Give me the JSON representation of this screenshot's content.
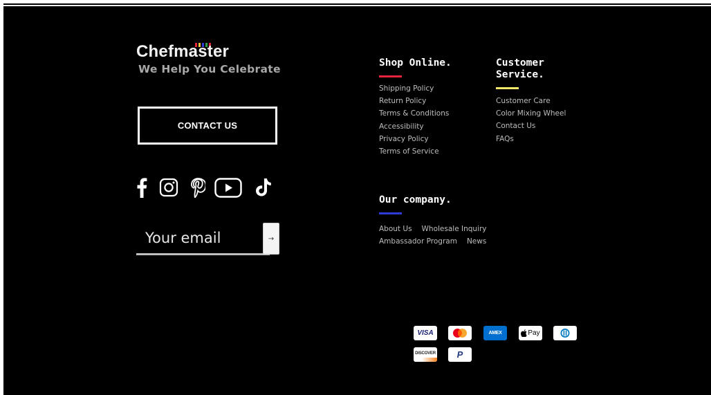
{
  "brand": {
    "logo_text": "Chefmaster",
    "tagline": "We Help You Celebrate"
  },
  "contact_button": {
    "label": "CONTACT US"
  },
  "social": [
    {
      "name": "facebook-icon"
    },
    {
      "name": "instagram-icon"
    },
    {
      "name": "pinterest-icon"
    },
    {
      "name": "youtube-icon"
    },
    {
      "name": "tiktok-icon"
    }
  ],
  "newsletter": {
    "placeholder": "Your email",
    "submit_glyph": "→"
  },
  "shop_online": {
    "title": "Shop Online.",
    "accent": "#e8243a",
    "links": [
      "Shipping Policy",
      "Return Policy",
      "Terms & Conditions",
      "Accessibility",
      "Privacy Policy",
      "Terms of Service"
    ]
  },
  "customer_service": {
    "title_line1": "Customer",
    "title_line2": "Service.",
    "accent": "#f3e86a",
    "links": [
      "Customer Care",
      "Color Mixing Wheel",
      "Contact Us",
      "FAQs"
    ]
  },
  "our_company": {
    "title": "Our company.",
    "accent": "#2d3cd6",
    "links_row1": [
      "About Us",
      "Wholesale Inquiry"
    ],
    "links_row2": [
      "Ambassador Program",
      "News"
    ]
  },
  "payments": {
    "visa": "VISA",
    "amex": "AMEX",
    "applepay": "Pay",
    "discover": "DISCOVER",
    "paypal": "P"
  }
}
